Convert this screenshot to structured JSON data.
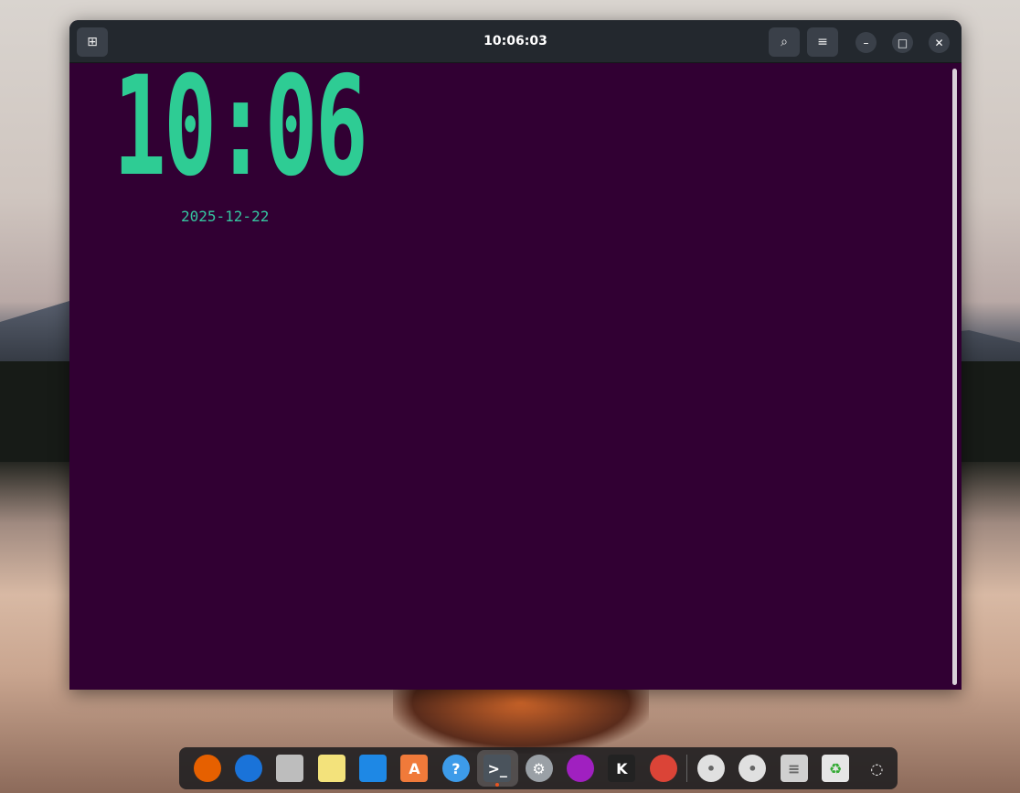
{
  "window": {
    "title": "10:06:03",
    "new_tab_icon": "new-tab-icon",
    "search_icon": "search-icon",
    "menu_icon": "menu-icon",
    "minimize": "–",
    "maximize": "□",
    "close": "✕"
  },
  "clock": {
    "time": "10:06",
    "date": "2025-12-22",
    "color": "#2ecc94"
  },
  "dock": {
    "items": [
      {
        "name": "firefox",
        "glyph": "",
        "color": "#e66000"
      },
      {
        "name": "thunderbird",
        "glyph": "",
        "color": "#1a73d9"
      },
      {
        "name": "files",
        "glyph": "",
        "color": "#bdbdbd"
      },
      {
        "name": "rhythmbox",
        "glyph": "",
        "color": "#f3e27b"
      },
      {
        "name": "libreoffice-writer",
        "glyph": "",
        "color": "#1e88e5"
      },
      {
        "name": "app-center",
        "glyph": "A",
        "color": "#f07a3a"
      },
      {
        "name": "help",
        "glyph": "?",
        "color": "#3d9be9"
      },
      {
        "name": "terminal",
        "glyph": ">_",
        "color": "#4a535c"
      },
      {
        "name": "settings",
        "glyph": "⚙",
        "color": "#9aa0a6"
      },
      {
        "name": "flame",
        "glyph": "",
        "color": "#a020c0"
      },
      {
        "name": "kolourpaint",
        "glyph": "K",
        "color": "#222"
      },
      {
        "name": "chrome",
        "glyph": "",
        "color": "#db4437"
      },
      {
        "name": "disc-1",
        "glyph": "•",
        "color": "#e0e0e0"
      },
      {
        "name": "disc-2",
        "glyph": "•",
        "color": "#e0e0e0"
      },
      {
        "name": "floppy",
        "glyph": "≡",
        "color": "#d0d0d0"
      },
      {
        "name": "trash",
        "glyph": "♻",
        "color": "#e6e6e6"
      },
      {
        "name": "show-apps",
        "glyph": "◌",
        "color": "transparent"
      }
    ]
  }
}
